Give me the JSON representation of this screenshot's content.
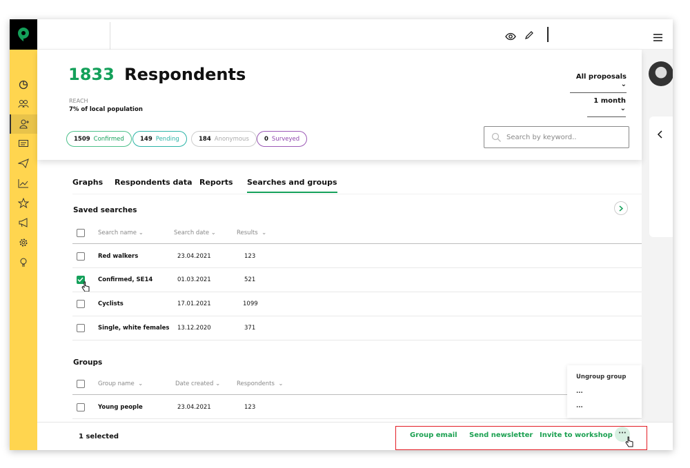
{
  "colors": {
    "accent": "#14a05a",
    "sidebar": "#ffd54f",
    "pending": "#2ab3a6",
    "anonymous": "#aaaaaa",
    "surveyed": "#8e44ad",
    "highlight": "#e31b23"
  },
  "topbar": {
    "icons": [
      "eye-icon",
      "pencil-icon",
      "hamburger-menu-icon"
    ]
  },
  "sidebar": {
    "items": [
      "pie-chart-icon",
      "people-icon",
      "add-user-icon",
      "chat-icon",
      "send-icon",
      "line-chart-icon",
      "star-icon",
      "megaphone-icon",
      "gear-icon",
      "lightbulb-icon"
    ],
    "active": "add-user-icon"
  },
  "header": {
    "count": "1833",
    "title": "Respondents",
    "reach_label": "REACH",
    "reach_value": "7% of local population",
    "pills": [
      {
        "count": "1509",
        "label": "Confirmed"
      },
      {
        "count": "149",
        "label": "Pending"
      },
      {
        "count": "184",
        "label": "Anonymous"
      },
      {
        "count": "0",
        "label": "Surveyed"
      }
    ],
    "proposals_select": "All proposals",
    "period_select": "1 month",
    "search_placeholder": "Search by keyword.."
  },
  "tabs": [
    {
      "label": "Graphs"
    },
    {
      "label": "Respondents data"
    },
    {
      "label": "Reports"
    },
    {
      "label": "Searches and groups",
      "active": true
    }
  ],
  "saved_searches": {
    "title": "Saved searches",
    "columns": [
      "Search name",
      "Search date",
      "Results"
    ],
    "rows": [
      {
        "name": "Red walkers",
        "date": "23.04.2021",
        "results": "123",
        "checked": false
      },
      {
        "name": "Confirmed, SE14",
        "date": "01.03.2021",
        "results": "521",
        "checked": true
      },
      {
        "name": "Cyclists",
        "date": "17.01.2021",
        "results": "1099",
        "checked": false
      },
      {
        "name": "Single, white females",
        "date": "13.12.2020",
        "results": "371",
        "checked": false
      }
    ]
  },
  "groups": {
    "title": "Groups",
    "columns": [
      "Group name",
      "Date created",
      "Respondents"
    ],
    "rows": [
      {
        "name": "Young people",
        "date": "23.04.2021",
        "respondents": "123",
        "checked": false
      }
    ]
  },
  "context_menu": {
    "items": [
      "Ungroup group",
      "...",
      "..."
    ]
  },
  "bottom_bar": {
    "selected": "1 selected",
    "actions": [
      "Group email",
      "Send newsletter",
      "Invite to workshop"
    ],
    "more": "···"
  }
}
